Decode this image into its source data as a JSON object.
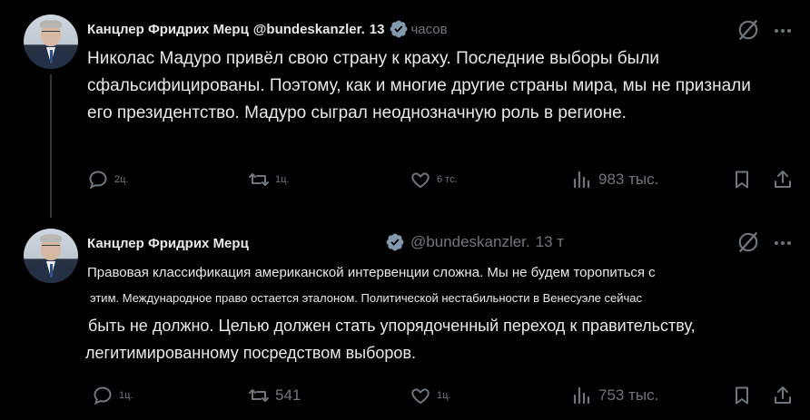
{
  "tweets": [
    {
      "author_name": "Канцлер Фридрих Мерц",
      "handle": "@bundeskanzler.",
      "time": "13",
      "time_suffix": "часов",
      "text": "Николас Мадуро привёл свою страну к краху. Последние выборы были сфальсифицированы. Поэтому, как и многие другие страны мира, мы не признали его президентство. Мадуро сыграл неоднозначную роль в регионе.",
      "replies": "2ц.",
      "reposts": "1ц.",
      "likes": "6 тс.",
      "views": "983 тыс."
    },
    {
      "author_name": "Канцлер Фридрих Мерц",
      "handle": "@bundeskanzler.",
      "time": "13 т",
      "text_lines": [
        "Правовая классификация американской интервенции сложна. Мы не будем торопиться с",
        "этим. Международное право остается эталоном. Политической нестабильности в Венесуэле сейчас",
        "быть не должно. Целью должен стать упорядоченный переход к правительству,",
        "легитимированному посредством выборов."
      ],
      "replies": "1ц.",
      "reposts": "541",
      "likes": "1ц.",
      "views": "753 тыс."
    }
  ],
  "icons": {
    "verified": "verified-badge-icon",
    "grok": "grok-icon",
    "more": "more-icon",
    "reply": "reply-icon",
    "repost": "repost-icon",
    "like": "like-icon",
    "views": "views-icon",
    "bookmark": "bookmark-icon",
    "share": "share-icon"
  },
  "colors": {
    "background": "#000000",
    "text": "#e7e9ea",
    "muted": "#71767b",
    "verified": "#829aab"
  }
}
